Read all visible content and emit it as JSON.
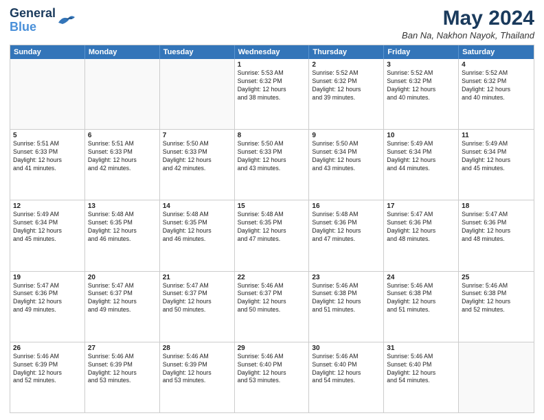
{
  "header": {
    "logo_line1": "General",
    "logo_line2": "Blue",
    "title": "May 2024",
    "subtitle": "Ban Na, Nakhon Nayok, Thailand"
  },
  "days_of_week": [
    "Sunday",
    "Monday",
    "Tuesday",
    "Wednesday",
    "Thursday",
    "Friday",
    "Saturday"
  ],
  "weeks": [
    [
      {
        "day": "",
        "info": "",
        "empty": true
      },
      {
        "day": "",
        "info": "",
        "empty": true
      },
      {
        "day": "",
        "info": "",
        "empty": true
      },
      {
        "day": "1",
        "info": "Sunrise: 5:53 AM\nSunset: 6:32 PM\nDaylight: 12 hours\nand 38 minutes.",
        "empty": false
      },
      {
        "day": "2",
        "info": "Sunrise: 5:52 AM\nSunset: 6:32 PM\nDaylight: 12 hours\nand 39 minutes.",
        "empty": false
      },
      {
        "day": "3",
        "info": "Sunrise: 5:52 AM\nSunset: 6:32 PM\nDaylight: 12 hours\nand 40 minutes.",
        "empty": false
      },
      {
        "day": "4",
        "info": "Sunrise: 5:52 AM\nSunset: 6:32 PM\nDaylight: 12 hours\nand 40 minutes.",
        "empty": false
      }
    ],
    [
      {
        "day": "5",
        "info": "Sunrise: 5:51 AM\nSunset: 6:33 PM\nDaylight: 12 hours\nand 41 minutes.",
        "empty": false
      },
      {
        "day": "6",
        "info": "Sunrise: 5:51 AM\nSunset: 6:33 PM\nDaylight: 12 hours\nand 42 minutes.",
        "empty": false
      },
      {
        "day": "7",
        "info": "Sunrise: 5:50 AM\nSunset: 6:33 PM\nDaylight: 12 hours\nand 42 minutes.",
        "empty": false
      },
      {
        "day": "8",
        "info": "Sunrise: 5:50 AM\nSunset: 6:33 PM\nDaylight: 12 hours\nand 43 minutes.",
        "empty": false
      },
      {
        "day": "9",
        "info": "Sunrise: 5:50 AM\nSunset: 6:34 PM\nDaylight: 12 hours\nand 43 minutes.",
        "empty": false
      },
      {
        "day": "10",
        "info": "Sunrise: 5:49 AM\nSunset: 6:34 PM\nDaylight: 12 hours\nand 44 minutes.",
        "empty": false
      },
      {
        "day": "11",
        "info": "Sunrise: 5:49 AM\nSunset: 6:34 PM\nDaylight: 12 hours\nand 45 minutes.",
        "empty": false
      }
    ],
    [
      {
        "day": "12",
        "info": "Sunrise: 5:49 AM\nSunset: 6:34 PM\nDaylight: 12 hours\nand 45 minutes.",
        "empty": false
      },
      {
        "day": "13",
        "info": "Sunrise: 5:48 AM\nSunset: 6:35 PM\nDaylight: 12 hours\nand 46 minutes.",
        "empty": false
      },
      {
        "day": "14",
        "info": "Sunrise: 5:48 AM\nSunset: 6:35 PM\nDaylight: 12 hours\nand 46 minutes.",
        "empty": false
      },
      {
        "day": "15",
        "info": "Sunrise: 5:48 AM\nSunset: 6:35 PM\nDaylight: 12 hours\nand 47 minutes.",
        "empty": false
      },
      {
        "day": "16",
        "info": "Sunrise: 5:48 AM\nSunset: 6:36 PM\nDaylight: 12 hours\nand 47 minutes.",
        "empty": false
      },
      {
        "day": "17",
        "info": "Sunrise: 5:47 AM\nSunset: 6:36 PM\nDaylight: 12 hours\nand 48 minutes.",
        "empty": false
      },
      {
        "day": "18",
        "info": "Sunrise: 5:47 AM\nSunset: 6:36 PM\nDaylight: 12 hours\nand 48 minutes.",
        "empty": false
      }
    ],
    [
      {
        "day": "19",
        "info": "Sunrise: 5:47 AM\nSunset: 6:36 PM\nDaylight: 12 hours\nand 49 minutes.",
        "empty": false
      },
      {
        "day": "20",
        "info": "Sunrise: 5:47 AM\nSunset: 6:37 PM\nDaylight: 12 hours\nand 49 minutes.",
        "empty": false
      },
      {
        "day": "21",
        "info": "Sunrise: 5:47 AM\nSunset: 6:37 PM\nDaylight: 12 hours\nand 50 minutes.",
        "empty": false
      },
      {
        "day": "22",
        "info": "Sunrise: 5:46 AM\nSunset: 6:37 PM\nDaylight: 12 hours\nand 50 minutes.",
        "empty": false
      },
      {
        "day": "23",
        "info": "Sunrise: 5:46 AM\nSunset: 6:38 PM\nDaylight: 12 hours\nand 51 minutes.",
        "empty": false
      },
      {
        "day": "24",
        "info": "Sunrise: 5:46 AM\nSunset: 6:38 PM\nDaylight: 12 hours\nand 51 minutes.",
        "empty": false
      },
      {
        "day": "25",
        "info": "Sunrise: 5:46 AM\nSunset: 6:38 PM\nDaylight: 12 hours\nand 52 minutes.",
        "empty": false
      }
    ],
    [
      {
        "day": "26",
        "info": "Sunrise: 5:46 AM\nSunset: 6:39 PM\nDaylight: 12 hours\nand 52 minutes.",
        "empty": false
      },
      {
        "day": "27",
        "info": "Sunrise: 5:46 AM\nSunset: 6:39 PM\nDaylight: 12 hours\nand 53 minutes.",
        "empty": false
      },
      {
        "day": "28",
        "info": "Sunrise: 5:46 AM\nSunset: 6:39 PM\nDaylight: 12 hours\nand 53 minutes.",
        "empty": false
      },
      {
        "day": "29",
        "info": "Sunrise: 5:46 AM\nSunset: 6:40 PM\nDaylight: 12 hours\nand 53 minutes.",
        "empty": false
      },
      {
        "day": "30",
        "info": "Sunrise: 5:46 AM\nSunset: 6:40 PM\nDaylight: 12 hours\nand 54 minutes.",
        "empty": false
      },
      {
        "day": "31",
        "info": "Sunrise: 5:46 AM\nSunset: 6:40 PM\nDaylight: 12 hours\nand 54 minutes.",
        "empty": false
      },
      {
        "day": "",
        "info": "",
        "empty": true
      }
    ]
  ],
  "colors": {
    "header_bg": "#3375b9",
    "header_text": "#ffffff",
    "title_color": "#1a3a5c",
    "border": "#cccccc",
    "empty_bg": "#f0f0f0"
  }
}
